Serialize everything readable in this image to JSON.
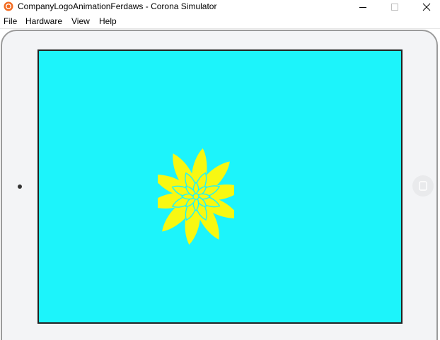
{
  "window": {
    "title": "CompanyLogoAnimationFerdaws - Corona Simulator",
    "minimize_icon": "minimize-icon",
    "maximize_icon": "maximize-icon",
    "close_icon": "close-icon"
  },
  "menu": {
    "items": [
      "File",
      "Hardware",
      "View",
      "Help"
    ]
  },
  "simulator": {
    "device": "tablet-landscape",
    "screen_color": "#1cf4fb",
    "logo_color": "#f8f812",
    "logo_icon": "flower-logo-icon"
  }
}
